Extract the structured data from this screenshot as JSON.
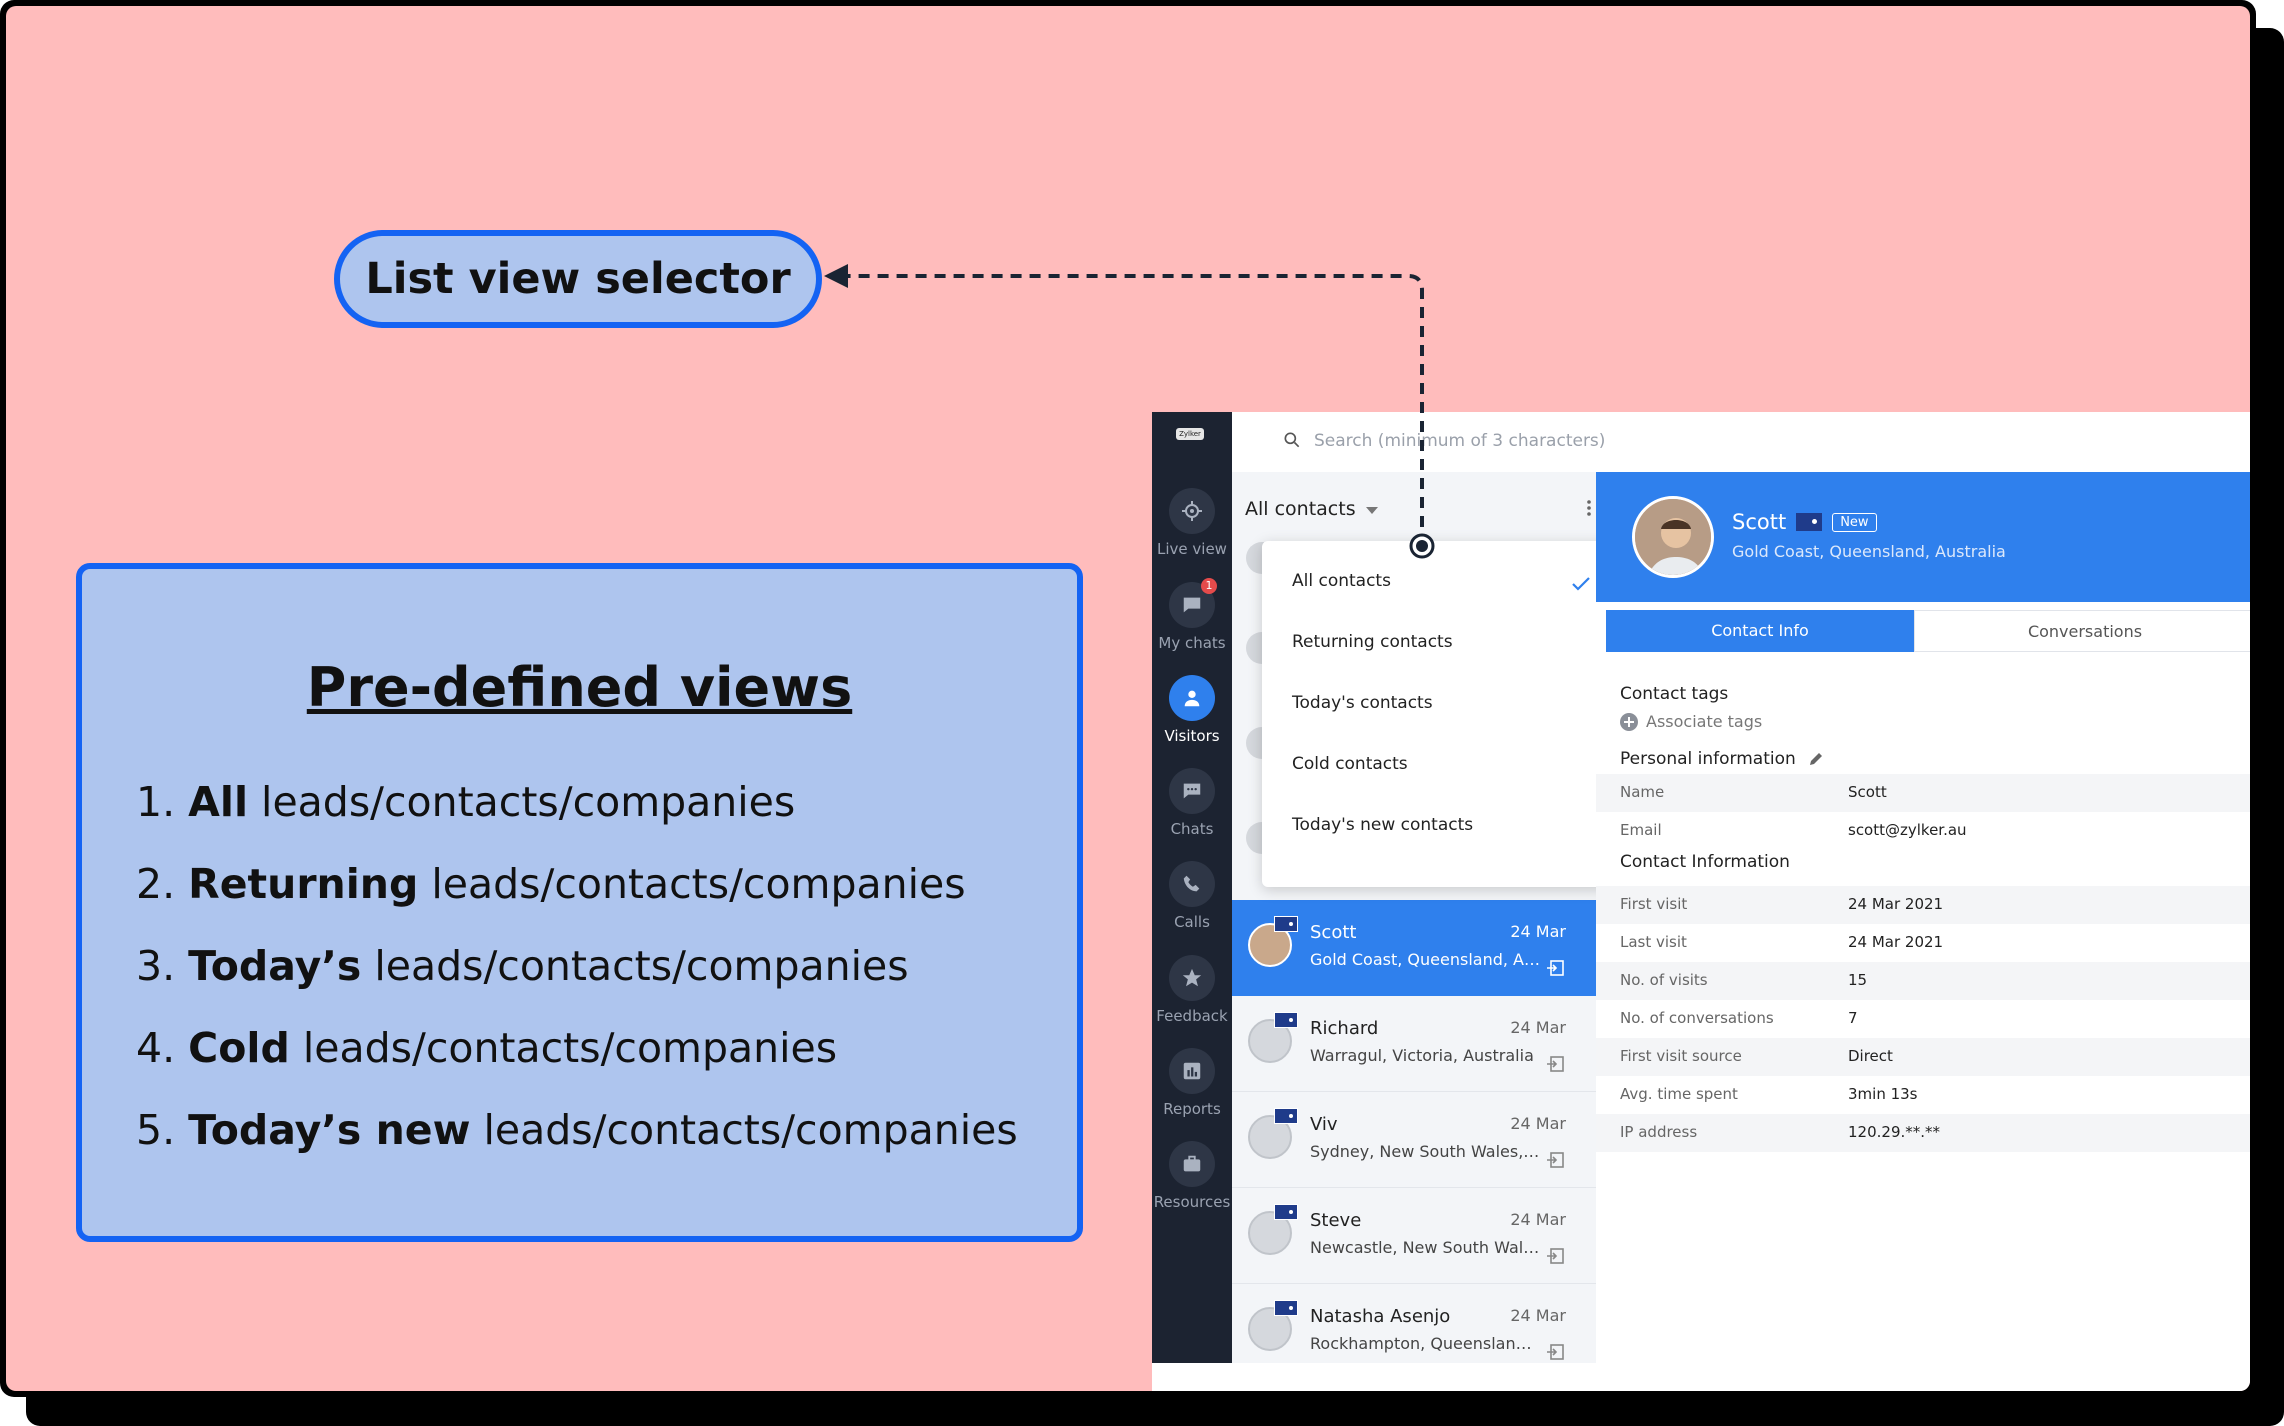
{
  "callout": {
    "label": "List view selector"
  },
  "views": {
    "title": "Pre-defined views",
    "items": [
      {
        "num": "1.",
        "bold": "All",
        "rest": " leads/contacts/companies"
      },
      {
        "num": "2.",
        "bold": "Returning",
        "rest": " leads/contacts/companies"
      },
      {
        "num": "3.",
        "bold": "Today’s",
        "rest": " leads/contacts/companies"
      },
      {
        "num": "4.",
        "bold": "Cold",
        "rest": " leads/contacts/companies"
      },
      {
        "num": "5.",
        "bold": "Today’s new",
        "rest": " leads/contacts/companies"
      }
    ]
  },
  "app": {
    "logo": "Zylker",
    "search_placeholder": "Search (minimum of 3 characters)",
    "nav": [
      {
        "label": "Live view",
        "icon": "target-icon"
      },
      {
        "label": "My chats",
        "icon": "chat-bubble-icon",
        "badge": "1"
      },
      {
        "label": "Visitors",
        "icon": "person-icon",
        "active": true
      },
      {
        "label": "Chats",
        "icon": "chats-icon"
      },
      {
        "label": "Calls",
        "icon": "phone-icon"
      },
      {
        "label": "Feedback",
        "icon": "star-icon"
      },
      {
        "label": "Reports",
        "icon": "bar-chart-icon"
      },
      {
        "label": "Resources",
        "icon": "briefcase-icon"
      }
    ],
    "list_selector": "All contacts",
    "dropdown": [
      {
        "label": "All contacts",
        "checked": true
      },
      {
        "label": "Returning contacts"
      },
      {
        "label": "Today's contacts"
      },
      {
        "label": "Cold contacts"
      },
      {
        "label": "Today's new contacts"
      }
    ],
    "contacts": [
      {
        "name": "Scott",
        "location": "Gold Coast, Queensland, Australia",
        "date": "24 Mar",
        "selected": true
      },
      {
        "name": "Richard",
        "location": "Warragul, Victoria, Australia",
        "date": "24 Mar"
      },
      {
        "name": "Viv",
        "location": "Sydney, New South Wales, Australia",
        "date": "24 Mar"
      },
      {
        "name": "Steve",
        "location": "Newcastle, New South Wales, Australia",
        "date": "24 Mar"
      },
      {
        "name": "Natasha Asenjo",
        "location": "Rockhampton, Queensland, Australia",
        "date": "24 Mar"
      }
    ],
    "detail": {
      "name": "Scott",
      "badge": "New",
      "location": "Gold Coast, Queensland, Australia",
      "tabs": [
        "Contact Info",
        "Conversations"
      ],
      "tags_title": "Contact tags",
      "associate_tags": "Associate tags",
      "personal_title": "Personal information",
      "personal": [
        {
          "key": "Name",
          "value": "Scott"
        },
        {
          "key": "Email",
          "value": "scott@zylker.au"
        }
      ],
      "contact_title": "Contact Information",
      "contact_info": [
        {
          "key": "First visit",
          "value": "24 Mar 2021"
        },
        {
          "key": "Last visit",
          "value": "24 Mar 2021"
        },
        {
          "key": "No. of visits",
          "value": "15"
        },
        {
          "key": "No. of conversations",
          "value": "7"
        },
        {
          "key": "First visit source",
          "value": "Direct"
        },
        {
          "key": "Avg. time spent",
          "value": "3min 13s"
        },
        {
          "key": "IP address",
          "value": "120.29.**.**"
        }
      ]
    }
  },
  "colors": {
    "background": "#ffbcbc",
    "accent": "#1463f3",
    "panel": "#aec5ee",
    "app_blue": "#2f80ed",
    "sidebar": "#1c2331"
  }
}
